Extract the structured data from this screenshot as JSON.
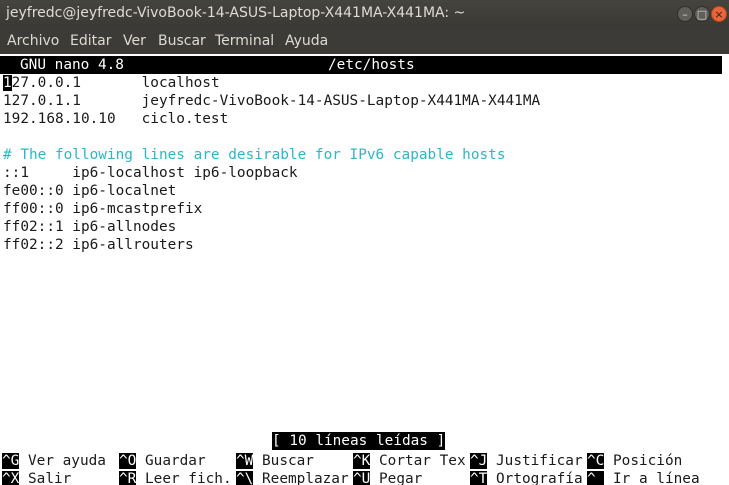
{
  "window": {
    "title": "jeyfredc@jeyfredc-VivoBook-14-ASUS-Laptop-X441MA-X441MA: ~",
    "minimize_glyph": "–",
    "maximize_glyph": "□",
    "close_glyph": "×"
  },
  "menu": [
    "Archivo",
    "Editar",
    "Ver",
    "Buscar",
    "Terminal",
    "Ayuda"
  ],
  "nano": {
    "version": "GNU nano 4.8",
    "filename": "/etc/hosts",
    "cursor_char": "1",
    "lines": [
      "27.0.0.1       localhost",
      "127.0.1.1       jeyfredc-VivoBook-14-ASUS-Laptop-X441MA-X441MA",
      "192.168.10.10   ciclo.test",
      "",
      "# The following lines are desirable for IPv6 capable hosts",
      "::1     ip6-localhost ip6-loopback",
      "fe00::0 ip6-localnet",
      "ff00::0 ip6-mcastprefix",
      "ff02::1 ip6-allnodes",
      "ff02::2 ip6-allrouters"
    ],
    "status": "[ 10 líneas leídas ]",
    "shortcuts_row1": [
      {
        "key": "^G",
        "label": " Ver ayuda"
      },
      {
        "key": "^O",
        "label": " Guardar"
      },
      {
        "key": "^W",
        "label": " Buscar"
      },
      {
        "key": "^K",
        "label": " Cortar Tex"
      },
      {
        "key": "^J",
        "label": " Justificar"
      },
      {
        "key": "^C",
        "label": " Posición"
      }
    ],
    "shortcuts_row2": [
      {
        "key": "^X",
        "label": " Salir"
      },
      {
        "key": "^R",
        "label": " Leer fich."
      },
      {
        "key": "^\\",
        "label": " Reemplazar"
      },
      {
        "key": "^U",
        "label": " Pegar"
      },
      {
        "key": "^T",
        "label": " Ortografía"
      },
      {
        "key": "^_",
        "label": " Ir a línea"
      }
    ]
  },
  "colors": {
    "titlebar": "#3c3b37",
    "close_button": "#e9663b",
    "terminal_bg": "#ffffff",
    "comment": "#2db6c7",
    "header_bg": "#000000"
  }
}
